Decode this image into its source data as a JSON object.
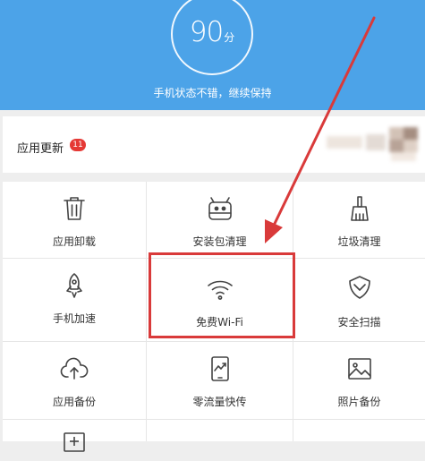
{
  "header": {
    "score_value": "90",
    "score_unit": "分",
    "status_text": "手机状态不错，继续保持",
    "background_color": "#4ca3e8"
  },
  "updates": {
    "label": "应用更新",
    "badge_count": "11",
    "badge_color": "#e53935"
  },
  "tools": [
    {
      "label": "应用卸载",
      "icon": "trash-icon"
    },
    {
      "label": "安装包清理",
      "icon": "android-package-icon"
    },
    {
      "label": "垃圾清理",
      "icon": "broom-icon"
    },
    {
      "label": "手机加速",
      "icon": "rocket-icon"
    },
    {
      "label": "免费Wi-Fi",
      "icon": "wifi-icon"
    },
    {
      "label": "安全扫描",
      "icon": "shield-icon"
    },
    {
      "label": "应用备份",
      "icon": "cloud-upload-icon"
    },
    {
      "label": "零流量快传",
      "icon": "phone-transfer-icon"
    },
    {
      "label": "照片备份",
      "icon": "photo-icon"
    }
  ],
  "annotation": {
    "highlight_color": "#d93a3a"
  }
}
